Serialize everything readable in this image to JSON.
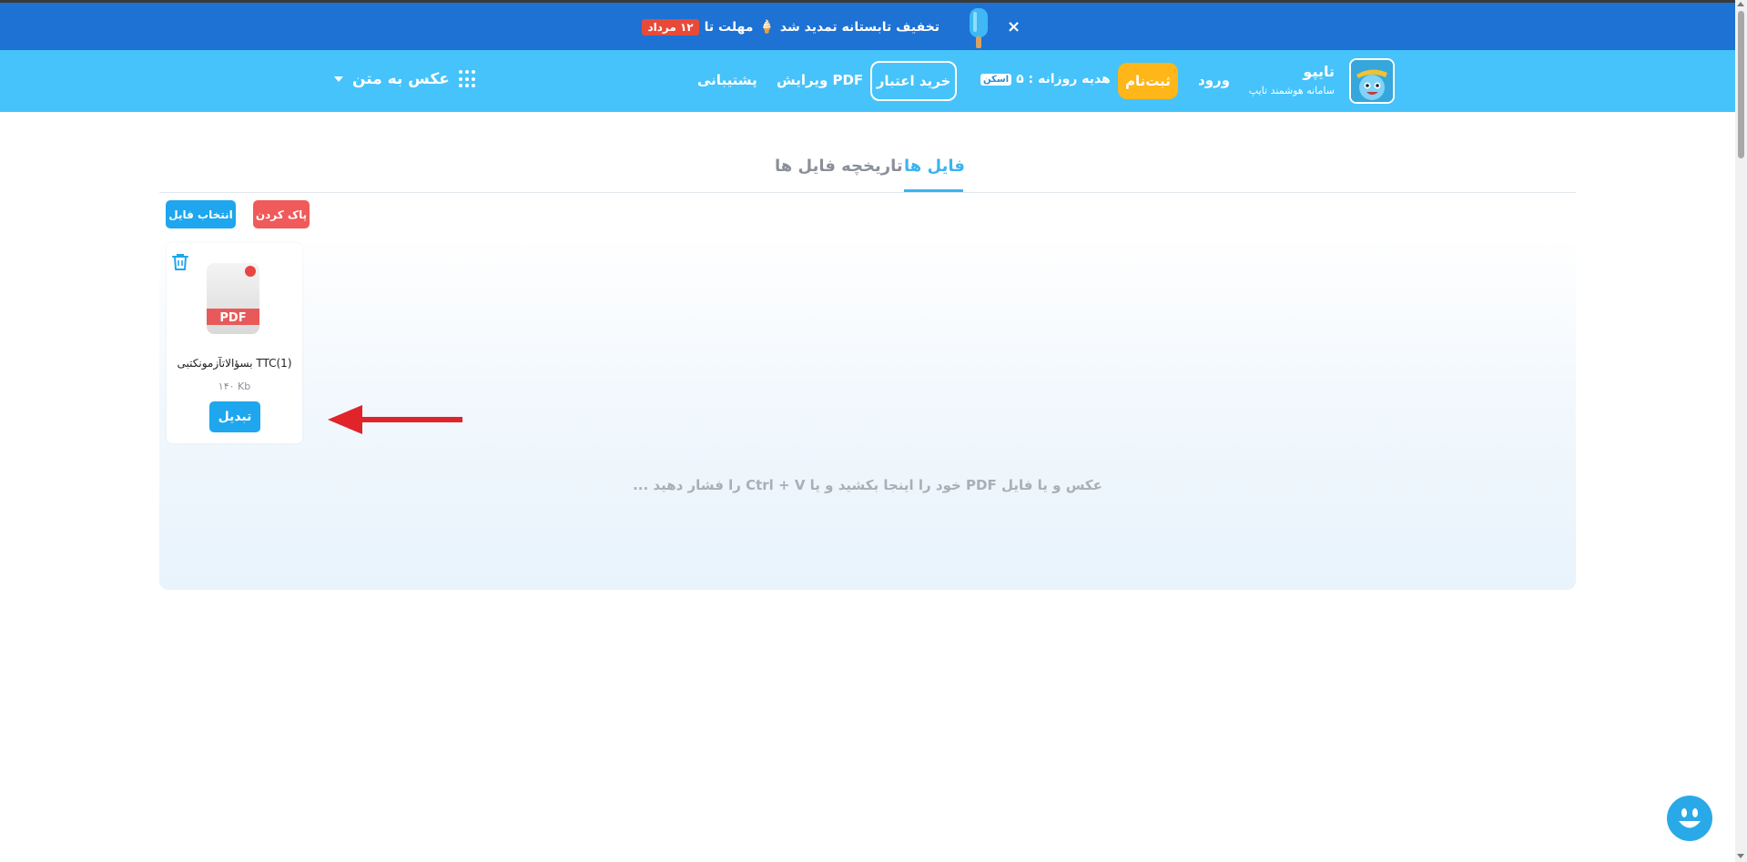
{
  "promo": {
    "text": "تخفیف تابستانه تمدید شد",
    "emoji": "🍦",
    "deadline_prefix": "مهلت تا",
    "deadline_badge": "۱۲ مرداد",
    "close_label": "×"
  },
  "header": {
    "brand_name": "تایپو",
    "brand_subtitle": "سامانه هوشمند تایپ",
    "login_label": "ورود",
    "signup_label": "ثبت‌نام",
    "daily_gift_label": "هدیه روزانه : ۵",
    "daily_gift_badge": "اسکن",
    "buy_credit_label": "خرید اعتبار",
    "edit_pdf_label": "ویرایش PDF",
    "support_label": "پشتیبانی",
    "tool_menu_label": "عکس به متن"
  },
  "tabs": {
    "files_label": "فایل ها",
    "history_label": "تاریخچه فایل ها"
  },
  "toolbar": {
    "clear_label": "پاک کردن",
    "select_file_label": "انتخاب فایل"
  },
  "file": {
    "name": "بسؤالاتآزمونکتبی TTC(1)",
    "size": "۱۴۰ Kb",
    "convert_label": "تبدیل",
    "icon_text": "PDF"
  },
  "dropzone": {
    "hint": "عکس و یا فایل PDF خود را اینجا بکشید و یا Ctrl + V را فشار دهید ..."
  },
  "colors": {
    "promo_bg": "#1d72d4",
    "nav_bg": "#45c3fa",
    "accent": "#3bb3f0",
    "signup_bg": "#ffb618",
    "danger": "#f05a5a",
    "primary_button": "#1ea6ee",
    "annotation_arrow": "#e0242a"
  }
}
